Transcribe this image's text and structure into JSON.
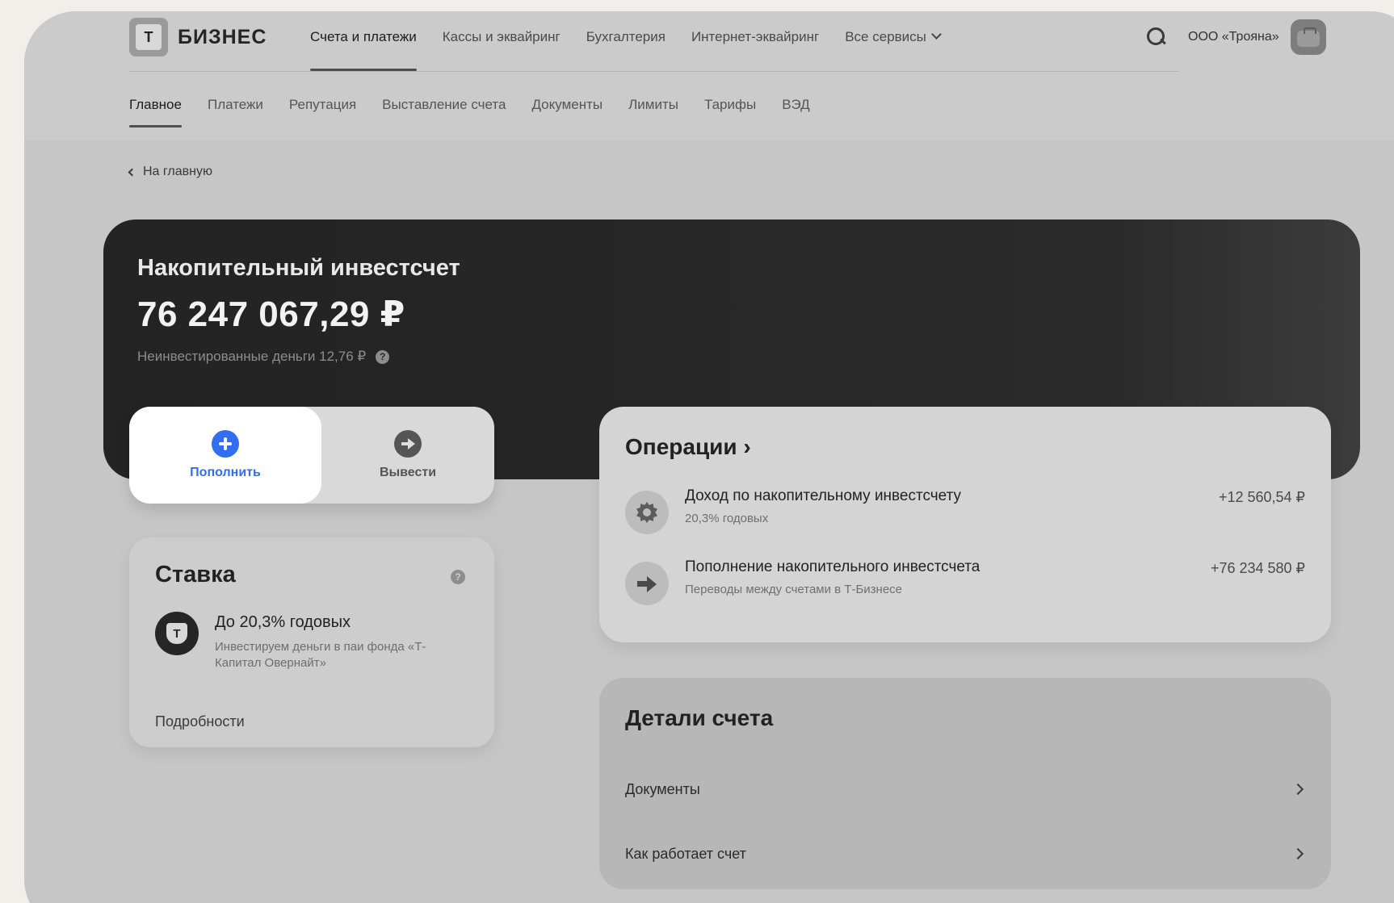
{
  "brand": {
    "logo_letter": "Т",
    "name": "БИЗНЕС"
  },
  "main_nav": [
    {
      "label": "Счета и платежи",
      "active": true
    },
    {
      "label": "Кассы и эквайринг",
      "active": false
    },
    {
      "label": "Бухгалтерия",
      "active": false
    },
    {
      "label": "Интернет-эквайринг",
      "active": false
    },
    {
      "label": "Все сервисы",
      "active": false
    }
  ],
  "header": {
    "company": "ООО «Трояна»",
    "search_icon": "search-icon",
    "avatar_icon": "briefcase-icon"
  },
  "sub_nav": [
    {
      "label": "Главное",
      "active": true
    },
    {
      "label": "Платежи",
      "active": false
    },
    {
      "label": "Репутация",
      "active": false
    },
    {
      "label": "Выставление счета",
      "active": false
    },
    {
      "label": "Документы",
      "active": false
    },
    {
      "label": "Лимиты",
      "active": false
    },
    {
      "label": "Тарифы",
      "active": false
    },
    {
      "label": "ВЭД",
      "active": false
    }
  ],
  "back_link": "На главную",
  "account": {
    "title": "Накопительный инвестсчет",
    "balance": "76 247 067,29 ₽",
    "uninvested": "Неинвестированные деньги 12,76 ₽",
    "help": "?"
  },
  "actions": {
    "topup": "Пополнить",
    "withdraw": "Вывести"
  },
  "rate": {
    "title": "Ставка",
    "help": "?",
    "logo_letter": "Т",
    "main": "До 20,3% годовых",
    "desc": "Инвестируем деньги в паи фонда «Т-Капитал Овернайт»",
    "more": "Подробности"
  },
  "operations": {
    "title": "Операции ›",
    "items": [
      {
        "name": "Доход по накопительному инвестсчету",
        "sub": "20,3% годовых",
        "amount": "+12 560,54 ₽",
        "icon": "gear-icon"
      },
      {
        "name": "Пополнение накопительного инвестсчета",
        "sub": "Переводы между счетами в Т-Бизнесе",
        "amount": "+76 234 580 ₽",
        "icon": "arrow-right-icon"
      }
    ]
  },
  "details": {
    "title": "Детали счета",
    "items": [
      {
        "label": "Документы"
      },
      {
        "label": "Как работает счет"
      }
    ]
  },
  "colors": {
    "accent": "#2f6ff0",
    "banner": "#232323",
    "background": "#c6c6c6"
  }
}
